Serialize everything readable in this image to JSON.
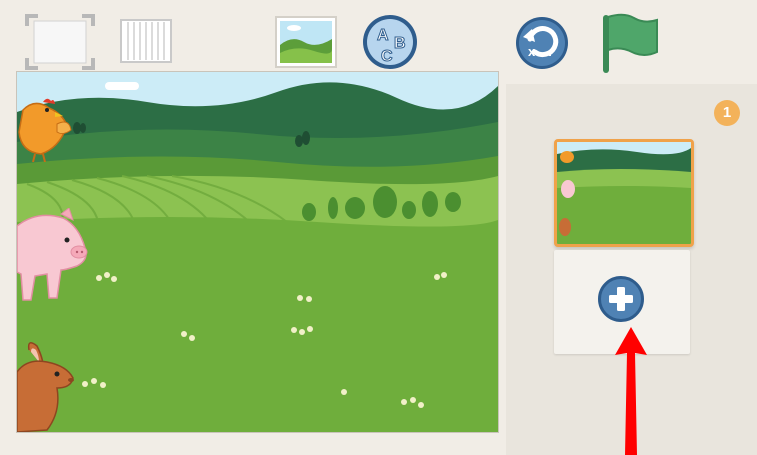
{
  "toolbar": {
    "buttons": [
      {
        "name": "fullscreen-button",
        "icon": "fullscreen-icon"
      },
      {
        "name": "grid-button",
        "icon": "grid-icon"
      },
      {
        "name": "background-button",
        "icon": "landscape-image-icon"
      },
      {
        "name": "text-button",
        "icon": "abc-text-icon",
        "glyphs": [
          "A",
          "B",
          "C"
        ]
      },
      {
        "name": "reset-button",
        "icon": "undo-reset-icon",
        "glyph": "x"
      },
      {
        "name": "green-flag-button",
        "icon": "green-flag-icon"
      }
    ]
  },
  "pages": {
    "count": "1",
    "add_button_icon": "plus-icon"
  },
  "stage": {
    "characters": [
      "chicken",
      "pig",
      "rabbit"
    ],
    "background": "farm-meadow"
  },
  "colors": {
    "accent_orange": "#f0a24a",
    "button_blue": "#4f82b4",
    "flag_green": "#4fa66a",
    "arrow_red": "#ff0000"
  }
}
